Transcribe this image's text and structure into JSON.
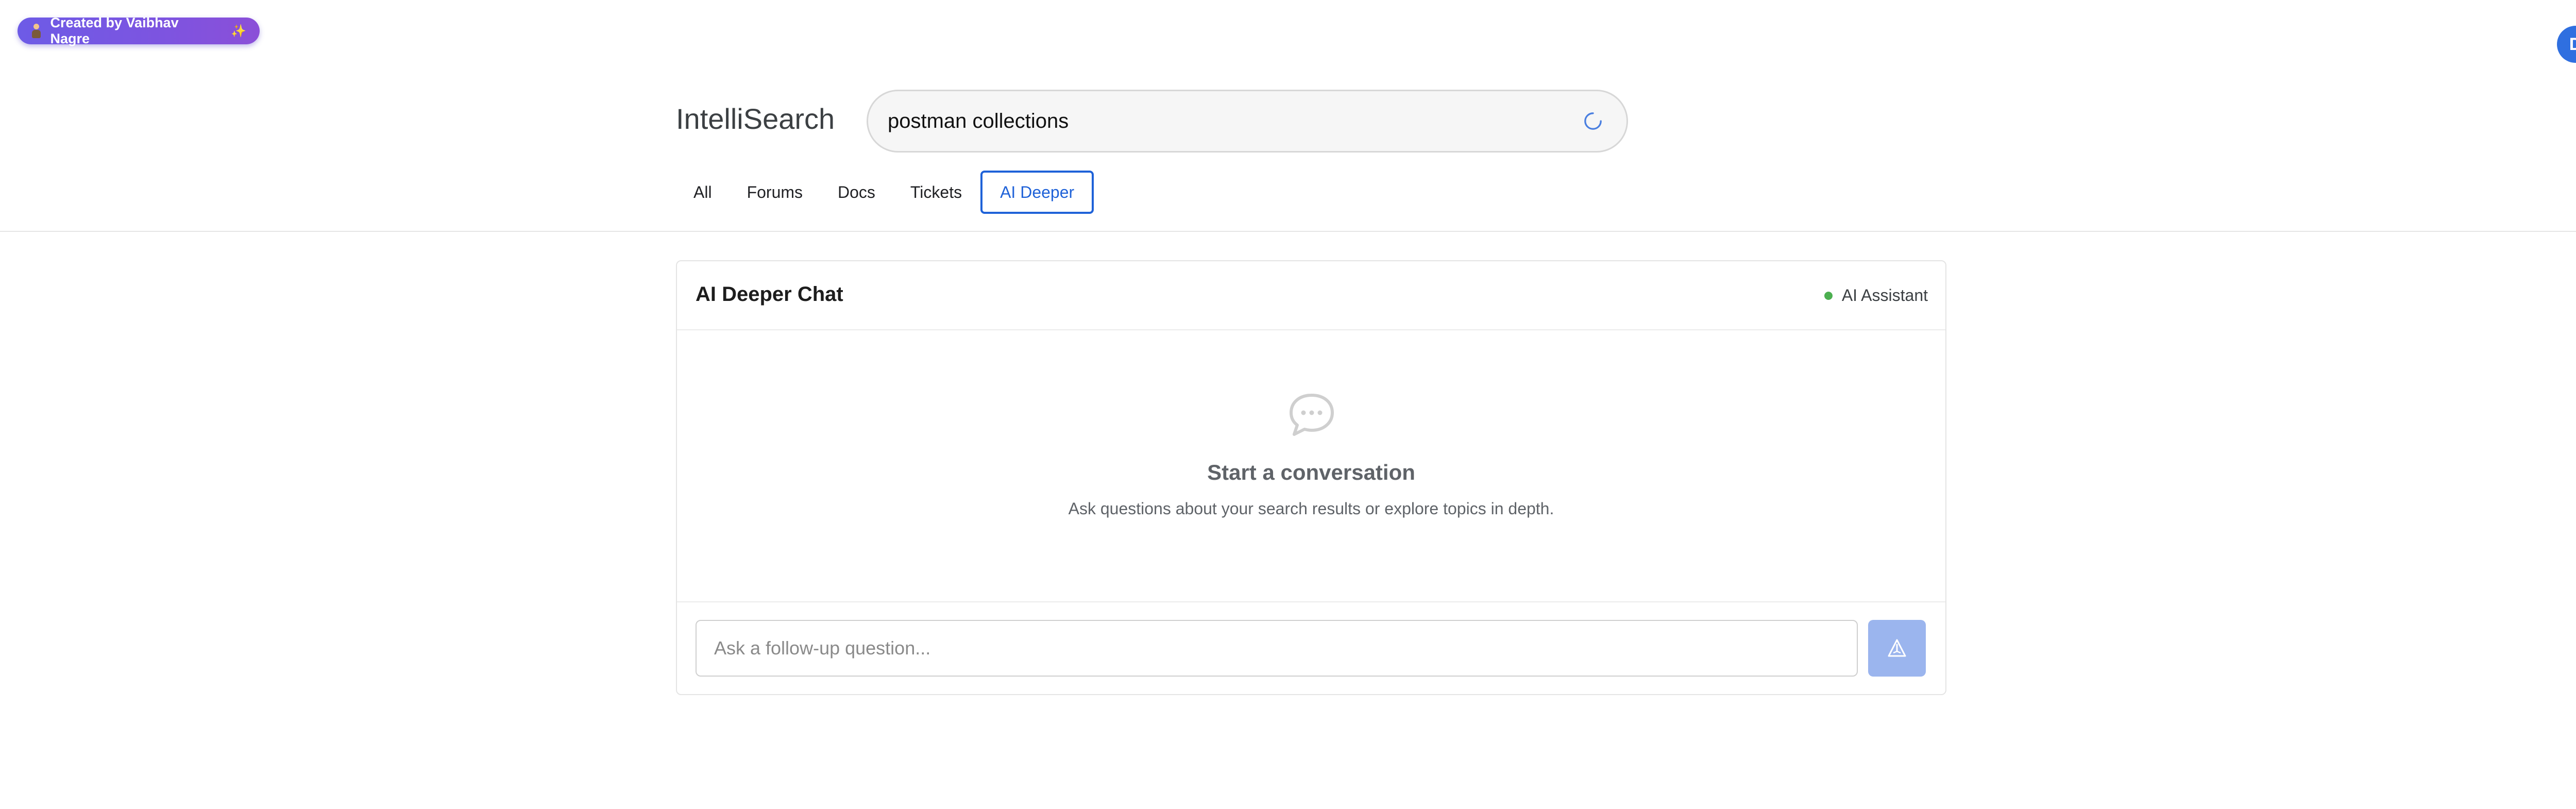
{
  "badge": {
    "label": "Created by Vaibhav Nagre",
    "emoji": "person-icon",
    "spark": "✨"
  },
  "user": {
    "avatar_initial": "D"
  },
  "header": {
    "app_title": "IntelliSearch"
  },
  "search": {
    "query": "postman collections",
    "loading": true
  },
  "tabs": [
    {
      "label": "All",
      "active": false
    },
    {
      "label": "Forums",
      "active": false
    },
    {
      "label": "Docs",
      "active": false
    },
    {
      "label": "Tickets",
      "active": false
    },
    {
      "label": "AI Deeper",
      "active": true
    }
  ],
  "chat": {
    "title": "AI Deeper Chat",
    "status_label": "AI Assistant",
    "status_color": "#4caf50",
    "empty_title": "Start a conversation",
    "empty_subtitle": "Ask questions about your search results or explore topics in depth.",
    "input_placeholder": "Ask a follow-up question...",
    "input_value": ""
  },
  "colors": {
    "accent": "#1f62d8",
    "badge": "#6d5be6",
    "send_disabled": "#9bb5ee"
  }
}
